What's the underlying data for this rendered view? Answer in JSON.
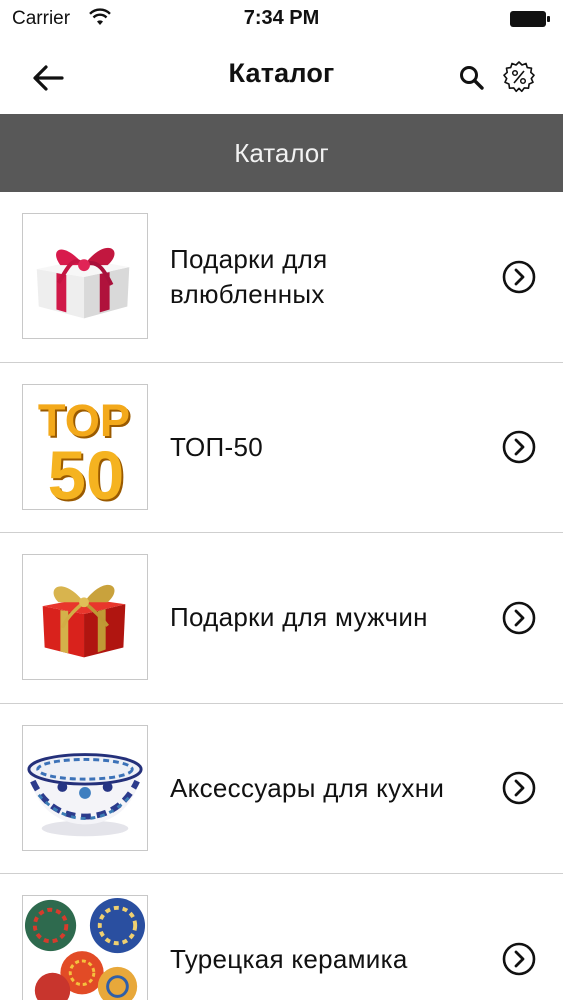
{
  "status_bar": {
    "carrier": "Carrier",
    "time": "7:34 PM",
    "icons": [
      "wifi-icon",
      "battery-icon"
    ]
  },
  "nav": {
    "title": "Каталог",
    "icons": [
      "back-arrow-icon",
      "search-icon",
      "discount-percent-icon"
    ]
  },
  "section": {
    "title": "Каталог"
  },
  "catalog": {
    "items": [
      {
        "label": "Подарки для влюбленных",
        "icon": "gift-box-icon"
      },
      {
        "label": "ТОП-50",
        "icon": "top-50-icon"
      },
      {
        "label": "Подарки для мужчин",
        "icon": "gift-box-icon"
      },
      {
        "label": "Аксессуары для кухни",
        "icon": "bowl-icon"
      },
      {
        "label": "Турецкая керамика",
        "icon": "ceramics-icon"
      }
    ]
  },
  "colors": {
    "section_header_bg": "#585858",
    "section_header_text": "#f2f2f2",
    "divider": "#cfcfcf"
  }
}
